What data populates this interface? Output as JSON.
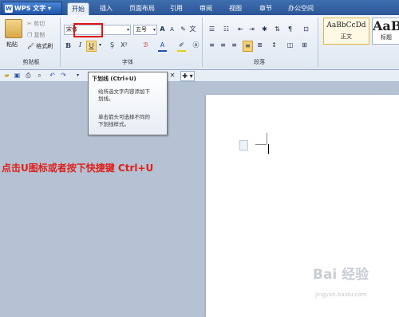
{
  "app": {
    "name": "WPS 文字"
  },
  "tabs": [
    "开始",
    "插入",
    "页面布局",
    "引用",
    "审阅",
    "视图",
    "章节",
    "办公空间"
  ],
  "clipboard": {
    "paste": "粘贴",
    "cut": "剪切",
    "copy": "复制",
    "format_painter": "格式刷",
    "group": "剪贴板"
  },
  "font": {
    "name": "宋体",
    "size": "五号",
    "bold": "B",
    "italic": "I",
    "underline": "U",
    "group": "字体"
  },
  "paragraph": {
    "group": "段落"
  },
  "styles": [
    {
      "sample": "AaBbCcDd",
      "name": "正文"
    },
    {
      "sample": "AaB",
      "name": "标题"
    }
  ],
  "tooltip": {
    "title": "下划线 (Ctrl+U)",
    "desc_line1": "给所选文字内容添加下",
    "desc_line2": "划线。",
    "hint_line1": "单击箭头可选择不同的",
    "hint_line2": "下划线样式。"
  },
  "instruction": "点击U图标或者按下快捷键 Ctrl+U",
  "watermark": {
    "line1": "Bai 经验",
    "line2": "jingyan.baidu.com"
  },
  "colors": {
    "highlight": "#e11717",
    "instruction": "#e0201b",
    "tab_bar": "#2b5596"
  }
}
